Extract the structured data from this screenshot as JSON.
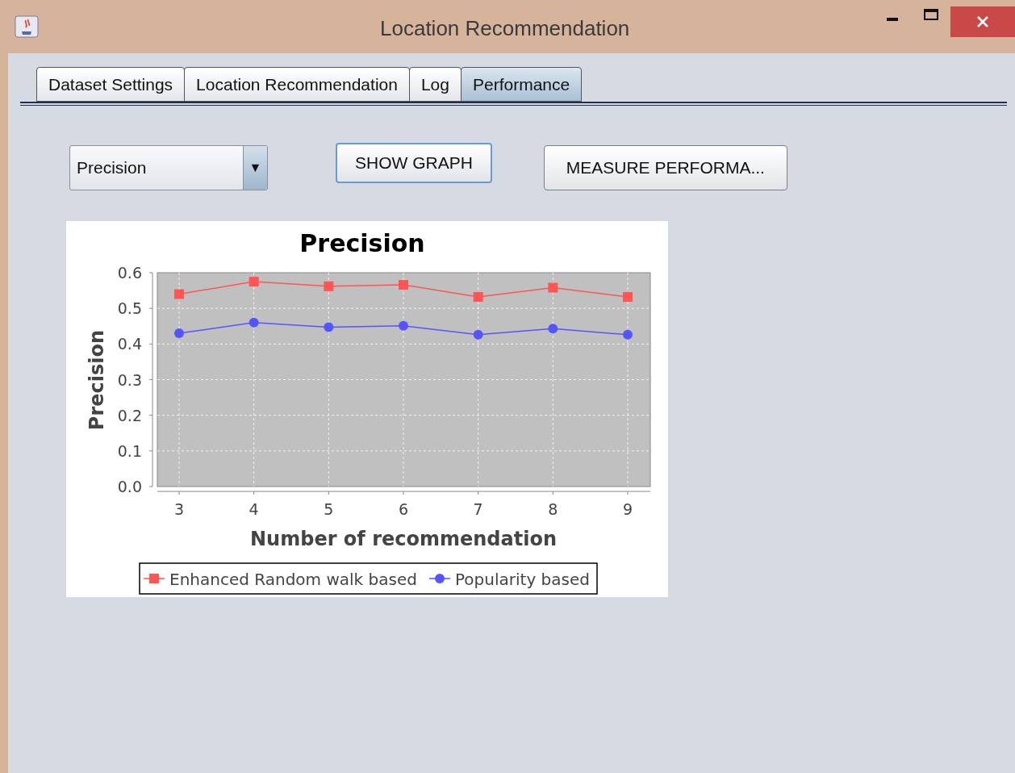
{
  "window": {
    "title": "Location Recommendation"
  },
  "tabs": [
    {
      "label": "Dataset Settings",
      "selected": false
    },
    {
      "label": "Location Recommendation",
      "selected": false
    },
    {
      "label": "Log",
      "selected": false
    },
    {
      "label": "Performance",
      "selected": true
    }
  ],
  "metric_dropdown": {
    "value": "Precision",
    "arrow": "▼"
  },
  "buttons": [
    {
      "label": "SHOW GRAPH",
      "focused": true
    },
    {
      "label": "MEASURE PERFORMA...",
      "focused": false
    }
  ],
  "chart": {
    "chart_data": {
      "type": "line",
      "grid": true,
      "legend": "bottom",
      "title": "Precision",
      "xlabel": "Number of recommendation",
      "ylabel": "Precision",
      "categories": [
        "3",
        "4",
        "5",
        "6",
        "7",
        "8",
        "9"
      ],
      "series": [
        {
          "name": "Enhanced Random walk based",
          "color": "#ff5555",
          "marker": "square",
          "values": [
            0.54,
            0.575,
            0.562,
            0.566,
            0.532,
            0.558,
            0.532
          ]
        },
        {
          "name": "Popularity based",
          "color": "#5555ff",
          "marker": "circle",
          "values": [
            0.43,
            0.46,
            0.447,
            0.451,
            0.426,
            0.443,
            0.426
          ]
        }
      ],
      "ylim": [
        0,
        0.6
      ],
      "yticks": [
        {
          "value": 0,
          "label": "0.0"
        },
        {
          "value": 0.1,
          "label": "0.1"
        },
        {
          "value": 0.2,
          "label": "0.2"
        },
        {
          "value": 0.3,
          "label": "0.3"
        },
        {
          "value": 0.4,
          "label": "0.4"
        },
        {
          "value": 0.5,
          "label": "0.5"
        },
        {
          "value": 0.6,
          "label": "0.6"
        }
      ]
    }
  }
}
